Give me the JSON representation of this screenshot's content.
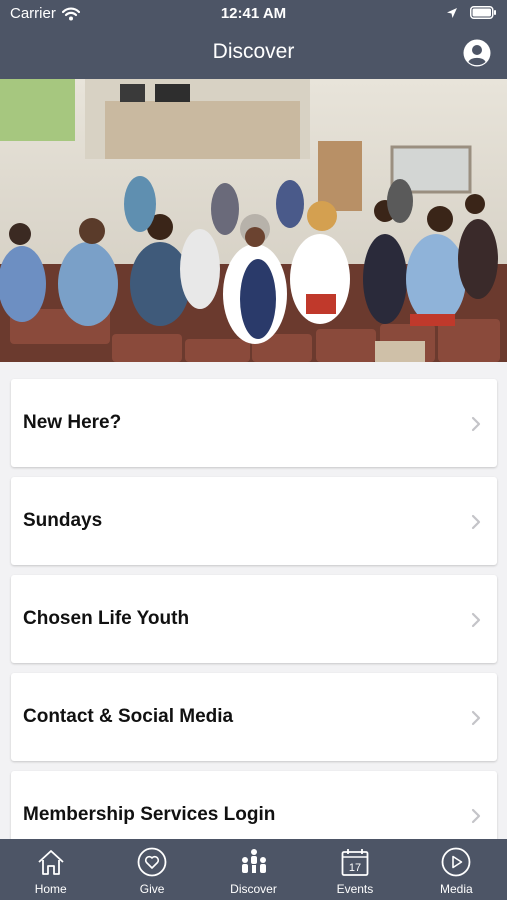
{
  "status_bar": {
    "carrier": "Carrier",
    "time": "12:41 AM",
    "icons": [
      "wifi-icon",
      "location-arrow-icon",
      "battery-icon"
    ]
  },
  "navbar": {
    "title": "Discover",
    "profile_icon": "profile-icon"
  },
  "hero": {
    "description_icon": "congregation-photo"
  },
  "menu": {
    "items": [
      {
        "label": "New Here?"
      },
      {
        "label": "Sundays"
      },
      {
        "label": "Chosen Life Youth"
      },
      {
        "label": "Contact & Social Media"
      },
      {
        "label": "Membership Services Login"
      }
    ]
  },
  "tabbar": {
    "tabs": [
      {
        "label": "Home",
        "icon": "home-icon"
      },
      {
        "label": "Give",
        "icon": "heart-icon"
      },
      {
        "label": "Discover",
        "icon": "people-icon",
        "active": true
      },
      {
        "label": "Events",
        "icon": "calendar-icon",
        "day": "17"
      },
      {
        "label": "Media",
        "icon": "play-icon"
      }
    ]
  },
  "colors": {
    "bar_background": "#4d5566",
    "page_background": "#f2f2f4",
    "card_background": "#ffffff"
  }
}
